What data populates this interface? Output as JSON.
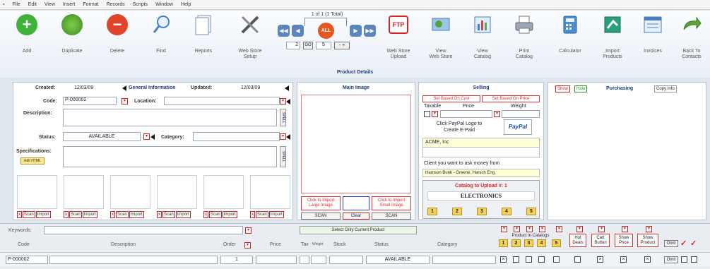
{
  "menu": [
    "File",
    "Edit",
    "View",
    "Insert",
    "Format",
    "Records",
    "Scripts",
    "Window",
    "Help"
  ],
  "toolbar": {
    "add": "Add",
    "duplicate": "Duplicate",
    "delete": "Delete",
    "find": "Find",
    "reports": "Reports",
    "web_store_setup": "Web Store\nSetup",
    "record_status": "1 of 1 (1 Total)",
    "all_label": "ALL",
    "record_no": "2",
    "go": "GO",
    "step": "5",
    "ftp": "FTP",
    "web_store_upload": "Web Store\nUpload",
    "view_web_store": "View\nWeb Store",
    "view_catalog": "View\nCatalog",
    "print_catalog": "Print\nCatalog",
    "calculator": "Calculator",
    "import_products": "Import\nProducts",
    "invoices": "Invoices",
    "back_to_contacts": "Back To\nContacts"
  },
  "title": "Product Details",
  "general": {
    "created_label": "Created:",
    "created_value": "12/03/09",
    "general_info": "General Information",
    "updated_label": "Updated:",
    "updated_value": "12/03/09",
    "code_label": "Code:",
    "code_value": "P-000002",
    "location_label": "Location:",
    "description_label": "Description:",
    "status_label": "Status:",
    "status_value": "AVAILABLE",
    "category_label": "Category:",
    "specifications_label": "Specifications:",
    "edit_html": "Edit HTML",
    "scan": "Scan",
    "import": "Import",
    "spell": "SPELL"
  },
  "main_image": {
    "title": "Main Image",
    "import_large": "Click to Import\nLarge Image",
    "import_small": "Click to Import\nSmall Image",
    "scan1": "SCAN",
    "clear": "Clear",
    "scan2": "SCAN"
  },
  "selling": {
    "title": "Selling",
    "set_cost": "Set Based On Cost",
    "set_price": "Set Based On Price",
    "taxable": "Taxable",
    "price": "Price",
    "weight": "Weight",
    "paypal_text": "Click PayPal Logo to\nCreate E-Paid",
    "paypal_logo": "PayPal",
    "company": "ACME, Inc",
    "client_text": "Client you want to ask money from",
    "client_value": "Harrison Bunk - Greene, Harsch Eng",
    "catalog_title": "Catalog to Upload #: 1",
    "catalog_value": "ELECTRONICS",
    "catalogs": [
      "1",
      "2",
      "3",
      "4",
      "5"
    ]
  },
  "purchasing": {
    "show": "Show",
    "hide": "Hide",
    "title": "Purchasing",
    "copy": "Copy Info"
  },
  "list": {
    "keywords_label": "Keywords:",
    "select_current": "Select Only Current Product",
    "in_catalogs": "Product In Catalogs",
    "catalog_nums": [
      "1",
      "2",
      "3",
      "4",
      "5"
    ],
    "hot_deals": "Hot\nDeals",
    "cart_button": "Cart\nButton",
    "show_price": "Show\nPrice",
    "show_product": "Show\nProduct",
    "omit": "Omit",
    "headers": {
      "code": "Code",
      "description": "Description",
      "order": "Order",
      "price": "Price",
      "tax": "Tax",
      "weight": "Weight",
      "stock": "Stock",
      "status": "Status",
      "category": "Category"
    },
    "row": {
      "code": "P-000002",
      "order": "1",
      "status": "AVAILABLE",
      "omit": "Omit"
    }
  }
}
